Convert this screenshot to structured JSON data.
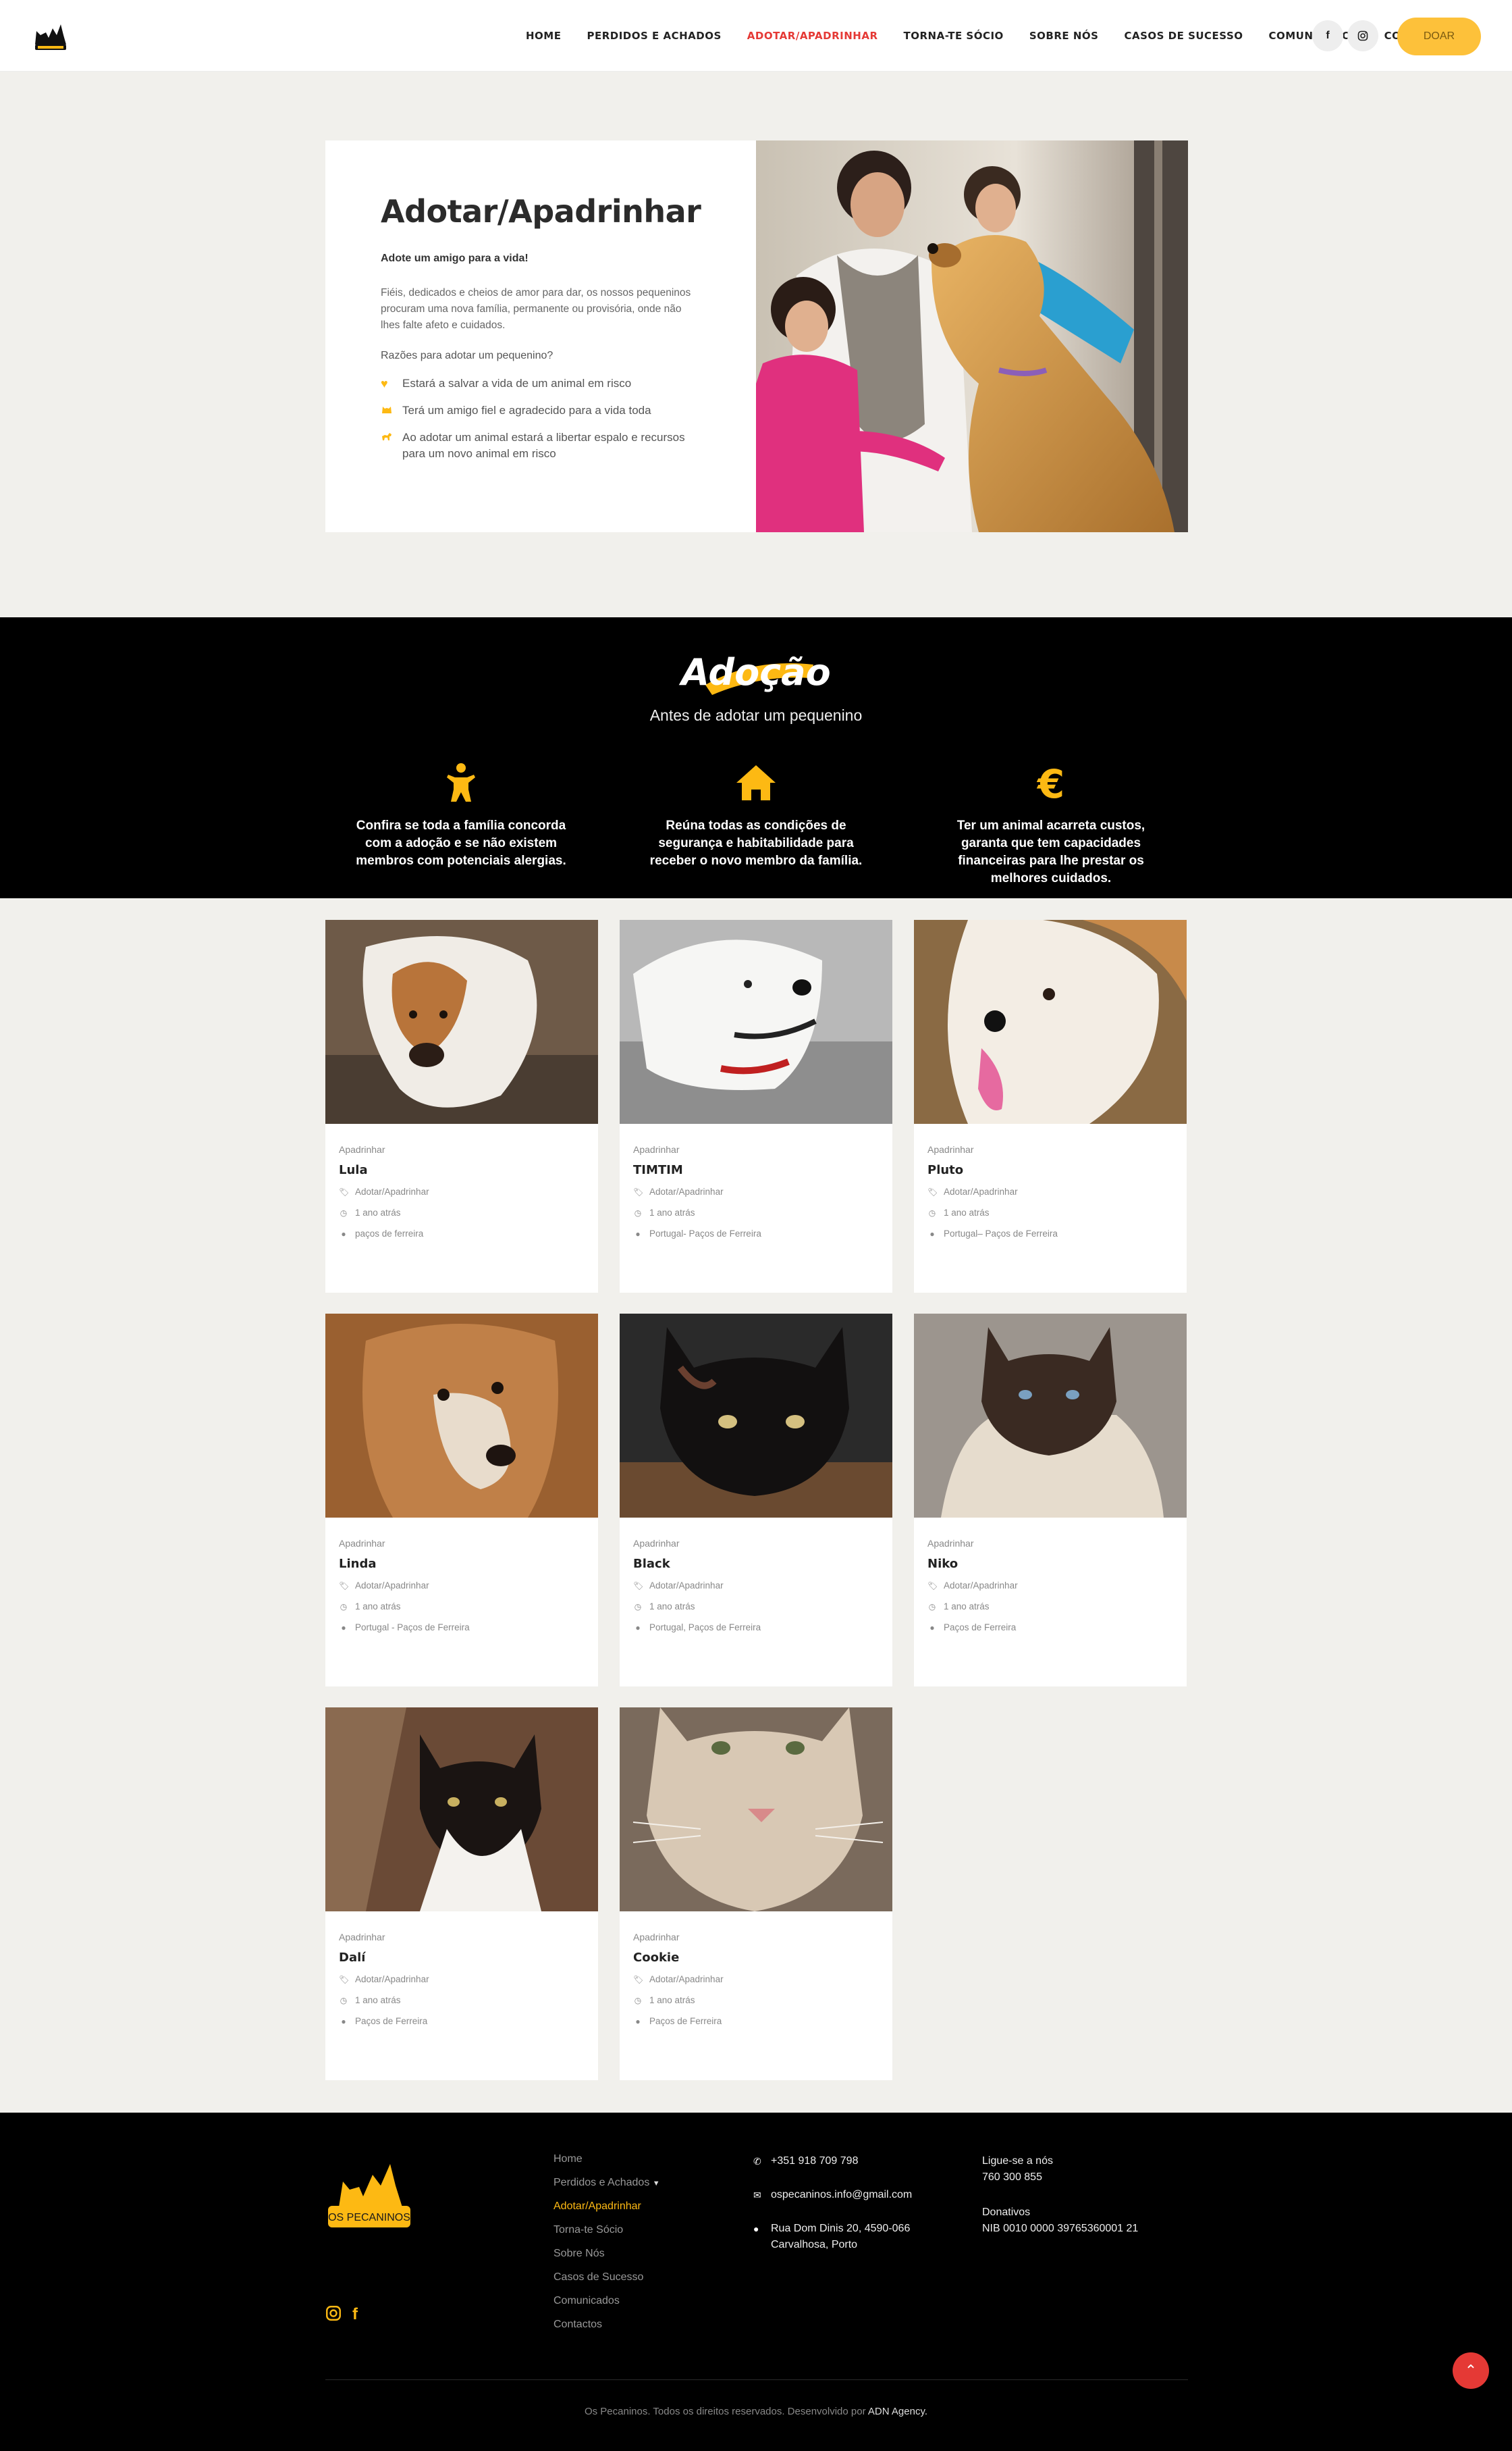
{
  "header": {
    "logo_text": "OS PECANINOS",
    "nav": [
      {
        "label": "HOME",
        "active": false
      },
      {
        "label": "PERDIDOS E ACHADOS",
        "active": false
      },
      {
        "label": "ADOTAR/APADRINHAR",
        "active": true
      },
      {
        "label": "TORNA-TE SÓCIO",
        "active": false
      },
      {
        "label": "SOBRE NÓS",
        "active": false
      },
      {
        "label": "CASOS DE SUCESSO",
        "active": false
      },
      {
        "label": "COMUNICADOS",
        "active": false
      },
      {
        "label": "CONTACTOS",
        "active": false
      }
    ],
    "facebook_icon": "f",
    "instagram_icon": "instagram-icon",
    "donate_label": "DOAR"
  },
  "intro": {
    "title": "Adotar/Apadrinhar",
    "subtitle": "Adote um amigo para a vida!",
    "paragraph": "Fiéis, dedicados e cheios de amor para dar, os nossos pequeninos procuram uma nova família, permanente ou provisória, onde não lhes falte afeto e cuidados.",
    "question": "Razões para adotar um pequenino?",
    "reasons": [
      {
        "icon": "heart-icon",
        "text": "Estará a salvar a vida de um animal em risco"
      },
      {
        "icon": "cat-icon",
        "text": "Terá um amigo fiel e agradecido para a vida toda"
      },
      {
        "icon": "dog-icon",
        "text": "Ao adotar um animal estará a libertar espalo e recursos para um novo animal em risco"
      }
    ]
  },
  "adoption": {
    "title": "Adoção",
    "subtitle": "Antes de adotar um pequenino",
    "steps": [
      {
        "icon": "child-icon",
        "text": "Confira se toda a família concorda com a adoção e se não existem membros com potenciais alergias."
      },
      {
        "icon": "home-icon",
        "text": "Reúna todas as condições de segurança e habitabilidade para receber o novo membro da família."
      },
      {
        "icon": "euro-icon",
        "text": "Ter um animal acarreta custos, garanta que tem capacidades financeiras para lhe prestar os melhores cuidados."
      }
    ]
  },
  "animals": [
    {
      "category": "Apadrinhar",
      "name": "Lula",
      "tag": "Adotar/Apadrinhar",
      "time": "1 ano atrás",
      "location": "paços de ferreira"
    },
    {
      "category": "Apadrinhar",
      "name": "TIMTIM",
      "tag": "Adotar/Apadrinhar",
      "time": "1 ano atrás",
      "location": "Portugal- Paços de Ferreira"
    },
    {
      "category": "Apadrinhar",
      "name": "Pluto",
      "tag": "Adotar/Apadrinhar",
      "time": "1 ano atrás",
      "location": "Portugal– Paços de Ferreira"
    },
    {
      "category": "Apadrinhar",
      "name": "Linda",
      "tag": "Adotar/Apadrinhar",
      "time": "1 ano atrás",
      "location": "Portugal - Paços de Ferreira"
    },
    {
      "category": "Apadrinhar",
      "name": "Black",
      "tag": "Adotar/Apadrinhar",
      "time": "1 ano atrás",
      "location": "Portugal, Paços de Ferreira"
    },
    {
      "category": "Apadrinhar",
      "name": "Niko",
      "tag": "Adotar/Apadrinhar",
      "time": "1 ano atrás",
      "location": "Paços de Ferreira"
    },
    {
      "category": "Apadrinhar",
      "name": "Dalí",
      "tag": "Adotar/Apadrinhar",
      "time": "1 ano atrás",
      "location": "Paços de Ferreira"
    },
    {
      "category": "Apadrinhar",
      "name": "Cookie",
      "tag": "Adotar/Apadrinhar",
      "time": "1 ano atrás",
      "location": "Paços de Ferreira"
    }
  ],
  "footer": {
    "logo_text": "OS PECANINOS",
    "links": [
      {
        "label": "Home",
        "active": false
      },
      {
        "label": "Perdidos e Achados",
        "active": false
      },
      {
        "label": "Adotar/Apadrinhar",
        "active": true
      },
      {
        "label": "Torna-te Sócio",
        "active": false
      },
      {
        "label": "Sobre Nós",
        "active": false
      },
      {
        "label": "Casos de Sucesso",
        "active": false
      },
      {
        "label": "Comunicados",
        "active": false
      },
      {
        "label": "Contactos",
        "active": false
      }
    ],
    "phone": "+351 918 709 798",
    "email": "ospecaninos.info@gmail.com",
    "address_line1": "Rua Dom Dinis 20, 4590-066",
    "address_line2": "Carvalhosa, Porto",
    "call_label": "Ligue-se a nós",
    "call_number": "760 300 855",
    "donations_label": "Donativos",
    "nib": "NIB 0010 0000 39765360001 21",
    "copyright": "Os Pecaninos. Todos os direitos reservados. Desenvolvido por",
    "agency": "ADN Agency."
  },
  "colors": {
    "accent": "#fdb913",
    "active_nav": "#e53935",
    "band_bg": "#000000",
    "page_bg": "#f1f0ec"
  }
}
